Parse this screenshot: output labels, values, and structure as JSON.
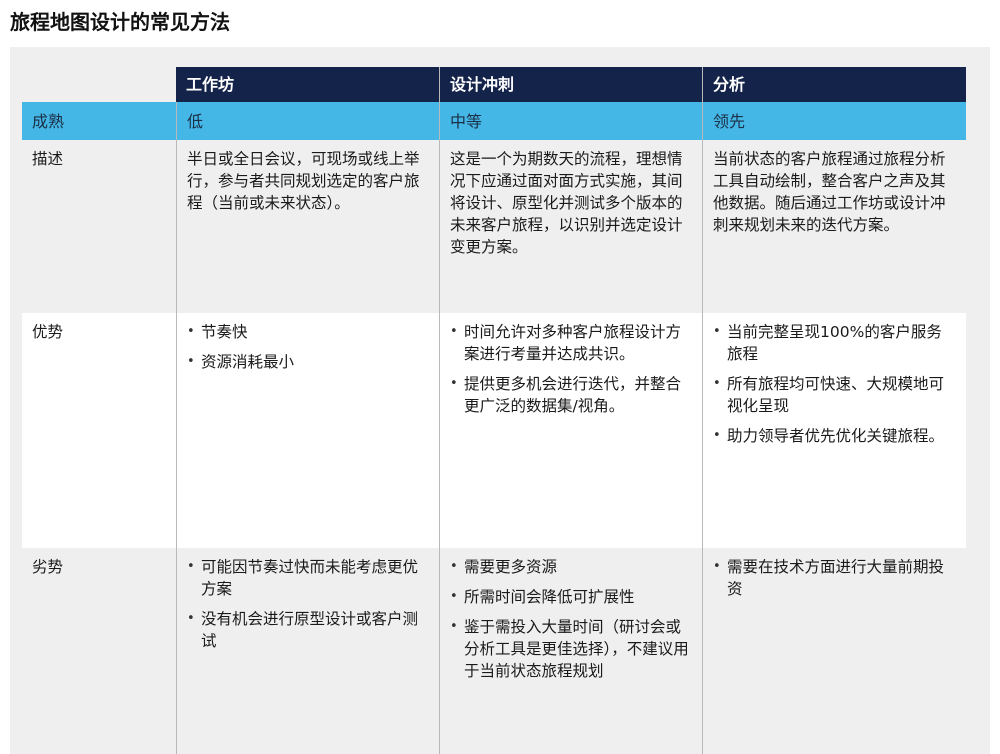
{
  "title": "旅程地图设计的常见方法",
  "columns": [
    "工作坊",
    "设计冲刺",
    "分析"
  ],
  "maturity": {
    "label": "成熟",
    "values": [
      "低",
      "中等",
      "领先"
    ]
  },
  "description": {
    "label": "描述",
    "values": [
      "半日或全日会议，可现场或线上举行，参与者共同规划选定的客户旅程（当前或未来状态）。",
      "这是一个为期数天的流程，理想情况下应通过面对面方式实施，其间将设计、原型化并测试多个版本的未来客户旅程，以识别并选定设计变更方案。",
      "当前状态的客户旅程通过旅程分析工具自动绘制，整合客户之声及其他数据。随后通过工作坊或设计冲刺来规划未来的迭代方案。"
    ]
  },
  "advantages": {
    "label": "优势",
    "values": [
      [
        "节奏快",
        "资源消耗最小"
      ],
      [
        "时间允许对多种客户旅程设计方案进行考量并达成共识。",
        "提供更多机会进行迭代，并整合更广泛的数据集/视角。"
      ],
      [
        "当前完整呈现100%的客户服务旅程",
        "所有旅程均可快速、大规模地可视化呈现",
        "助力领导者优先优化关键旅程。"
      ]
    ]
  },
  "disadvantages": {
    "label": "劣势",
    "values": [
      [
        "可能因节奏过快而未能考虑更优方案",
        "没有机会进行原型设计或客户测试"
      ],
      [
        "需要更多资源",
        "所需时间会降低可扩展性",
        "鉴于需投入大量时间（研讨会或分析工具是更佳选择），不建议用于当前状态旅程规划"
      ],
      [
        "需要在技术方面进行大量前期投资"
      ]
    ]
  }
}
